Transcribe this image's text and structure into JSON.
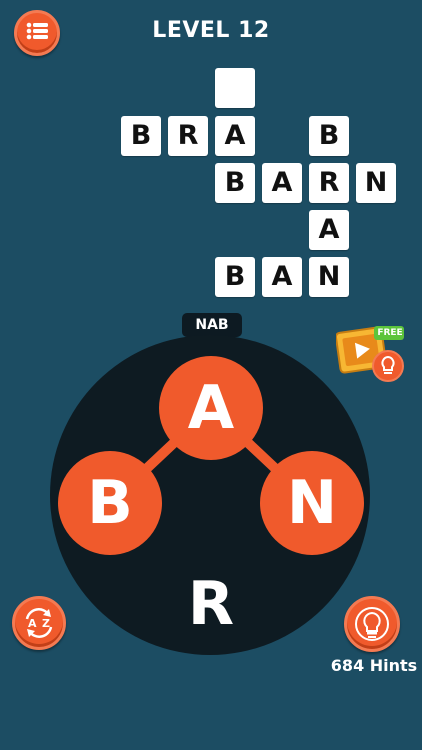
{
  "header": {
    "level_title": "LEVEL 12"
  },
  "puzzle": {
    "rows": [
      {
        "cells": [
          "",
          "",
          "",
          "",
          "",
          "",
          "",
          ""
        ]
      },
      {
        "cells": [
          "B",
          "R",
          "A",
          "",
          "B",
          "",
          "",
          ""
        ]
      },
      {
        "cells": [
          "",
          "",
          "B",
          "A",
          "R",
          "N",
          "",
          ""
        ]
      },
      {
        "cells": [
          "",
          "",
          "",
          "",
          "A",
          "",
          "",
          ""
        ]
      },
      {
        "cells": [
          "",
          "",
          "B",
          "A",
          "N",
          "",
          "",
          ""
        ]
      }
    ],
    "empty_cell_label": ""
  },
  "current_word": "NAB",
  "wheel": {
    "letters": [
      {
        "char": "A",
        "selected": true
      },
      {
        "char": "B",
        "selected": true
      },
      {
        "char": "N",
        "selected": true
      },
      {
        "char": "R",
        "selected": false
      }
    ]
  },
  "video_offer": {
    "badge": "FREE"
  },
  "hints": {
    "count_label": "684 Hints"
  },
  "icons": {
    "menu": "list-icon",
    "shuffle": "shuffle-az-icon",
    "hint": "lightbulb-icon",
    "video": "film-icon"
  },
  "colors": {
    "background": "#1c4d63",
    "accent": "#f05a2c",
    "wheel": "#0e1b22",
    "cell": "#ffffff"
  }
}
